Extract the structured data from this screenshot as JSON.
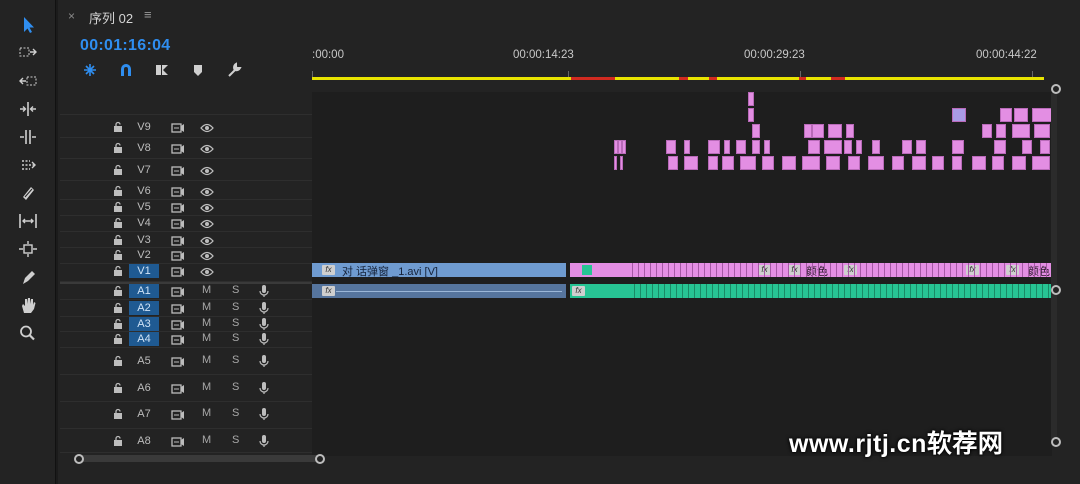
{
  "tab": {
    "close": "×",
    "title": "序列 02",
    "menu": "≡"
  },
  "timecode": "00:01:16:04",
  "controls": [
    "snap-icon",
    "magnet-icon",
    "linked-selection-icon",
    "marker-icon",
    "wrench-icon"
  ],
  "ruler": {
    "labels": [
      ":00:00",
      "00:00:14:23",
      "00:00:29:23",
      "00:00:44:22"
    ]
  },
  "video_tracks": [
    {
      "name": "V9",
      "selected": false
    },
    {
      "name": "V8",
      "selected": false
    },
    {
      "name": "V7",
      "selected": false
    },
    {
      "name": "V6",
      "selected": false
    },
    {
      "name": "V5",
      "selected": false
    },
    {
      "name": "V4",
      "selected": false
    },
    {
      "name": "V3",
      "selected": false
    },
    {
      "name": "V2",
      "selected": false
    },
    {
      "name": "V1",
      "selected": true
    }
  ],
  "audio_tracks": [
    {
      "name": "A1",
      "selected": true,
      "m": "M",
      "s": "S"
    },
    {
      "name": "A2",
      "selected": true,
      "m": "M",
      "s": "S"
    },
    {
      "name": "A3",
      "selected": true,
      "m": "M",
      "s": "S"
    },
    {
      "name": "A4",
      "selected": true,
      "m": "M",
      "s": "S"
    },
    {
      "name": "A5",
      "selected": false,
      "m": "M",
      "s": "S"
    },
    {
      "name": "A6",
      "selected": false,
      "m": "M",
      "s": "S"
    },
    {
      "name": "A7",
      "selected": false,
      "m": "M",
      "s": "S"
    },
    {
      "name": "A8",
      "selected": false,
      "m": "M",
      "s": "S"
    }
  ],
  "clips": {
    "v1_main_label": "对 话弹窗 _1.avi [V]",
    "fx": "fx",
    "color_label_1": "颜色",
    "color_label_2": "颜色"
  },
  "colors": {
    "accent": "#2f8ef0",
    "video_clip": "#6f9bd0",
    "pink_clip": "#e38ee3",
    "audio_clip": "#27c494",
    "ruler": "#e8e400",
    "red": "#d12a20"
  },
  "watermark": "www.rjtj.cn软荐网"
}
